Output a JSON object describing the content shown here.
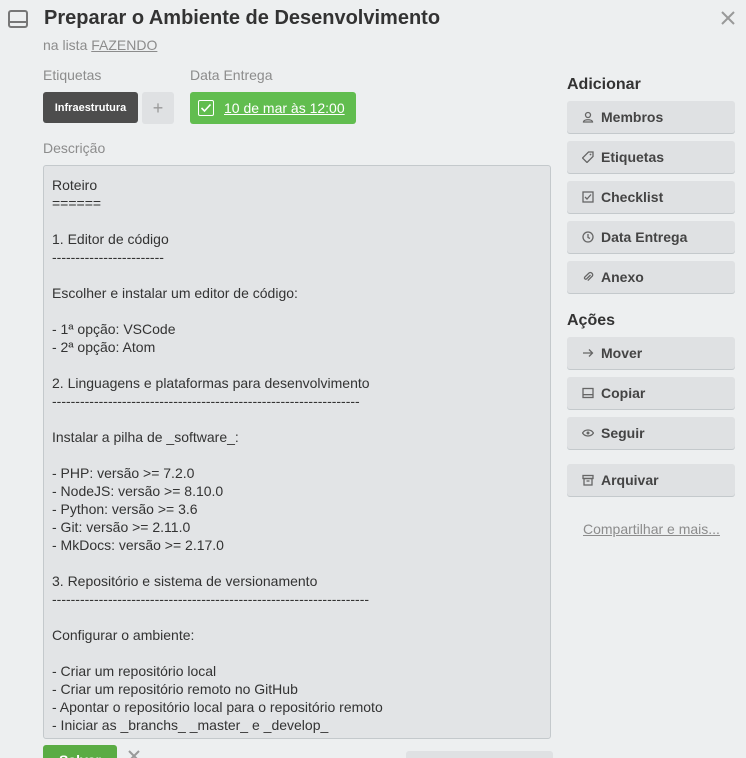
{
  "card": {
    "title": "Preparar o Ambiente de Desenvolvimento",
    "in_list_prefix": "na lista",
    "list_name": "FAZENDO"
  },
  "labels": {
    "heading": "Etiquetas",
    "items": [
      "Infraestrutura"
    ],
    "add": "+"
  },
  "due_date": {
    "heading": "Data Entrega",
    "value": "10 de mar às 12:00",
    "color": "#61bd4f"
  },
  "description": {
    "heading": "Descrição",
    "text": "Roteiro\n======\n\n1. Editor de código\n------------------------\n\nEscolher e instalar um editor de código:\n\n- 1ª opção: VSCode\n- 2ª opção: Atom\n\n2. Linguagens e plataformas para desenvolvimento\n------------------------------------------------------------------\n\nInstalar a pilha de _software_:\n\n- PHP: versão >= 7.2.0\n- NodeJS: versão >= 8.10.0\n- Python: versão >= 3.6\n- Git: versão >= 2.11.0\n- MkDocs: versão >= 2.17.0\n\n3. Repositório e sistema de versionamento\n--------------------------------------------------------------------\n\nConfigurar o ambiente:\n\n- Criar um repositório local\n- Criar um repositório remoto no GitHub\n- Apontar o repositório local para o repositório remoto\n- Iniciar as _branchs_ _master_ e _develop_",
    "save_label": "Salvar"
  },
  "sidebar": {
    "add_heading": "Adicionar",
    "add_items": [
      {
        "label": "Membros",
        "icon": "person-icon"
      },
      {
        "label": "Etiquetas",
        "icon": "tag-icon"
      },
      {
        "label": "Checklist",
        "icon": "checkbox-icon"
      },
      {
        "label": "Data Entrega",
        "icon": "clock-icon"
      },
      {
        "label": "Anexo",
        "icon": "paperclip-icon"
      }
    ],
    "actions_heading": "Ações",
    "action_items": [
      {
        "label": "Mover",
        "icon": "arrow-right-icon"
      },
      {
        "label": "Copiar",
        "icon": "card-icon"
      },
      {
        "label": "Seguir",
        "icon": "eye-icon"
      },
      {
        "label": "Arquivar",
        "icon": "archive-icon"
      }
    ],
    "share_link": "Compartilhar e mais..."
  }
}
